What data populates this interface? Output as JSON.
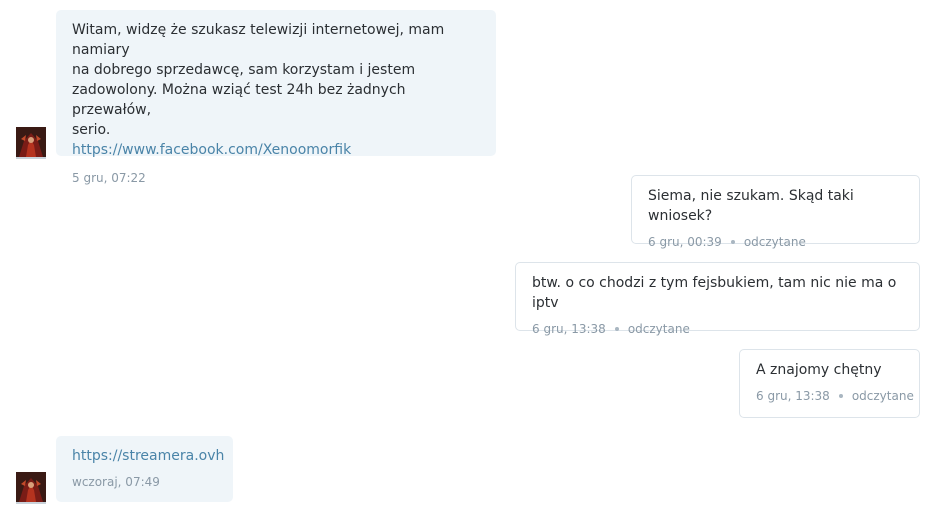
{
  "messages": [
    {
      "direction": "incoming",
      "text": "Witam, widzę że szukasz telewizji internetowej, mam namiary\nna dobrego sprzedawcę, sam korzystam i jestem\nzadowolony. Można wziąć test 24h bez żadnych przewałów,\nserio.",
      "link": "https://www.facebook.com/Xenoomorfik",
      "time": "5 gru, 07:22"
    },
    {
      "direction": "outgoing",
      "text": "Siema, nie szukam. Skąd taki wniosek?",
      "time": "6 gru, 00:39",
      "status": "odczytane"
    },
    {
      "direction": "outgoing",
      "text": "btw. o co chodzi z tym fejsbukiem, tam nic nie ma o iptv",
      "time": "6 gru, 13:38",
      "status": "odczytane"
    },
    {
      "direction": "outgoing",
      "text": "A znajomy chętny",
      "time": "6 gru, 13:38",
      "status": "odczytane"
    },
    {
      "direction": "incoming",
      "link": "https://streamera.ovh",
      "time": "wczoraj, 07:49"
    }
  ],
  "colors": {
    "incoming_bg": "#eff5f9",
    "outgoing_border": "#dde4ea",
    "link": "#4a84a8",
    "meta": "#8a99a6"
  }
}
